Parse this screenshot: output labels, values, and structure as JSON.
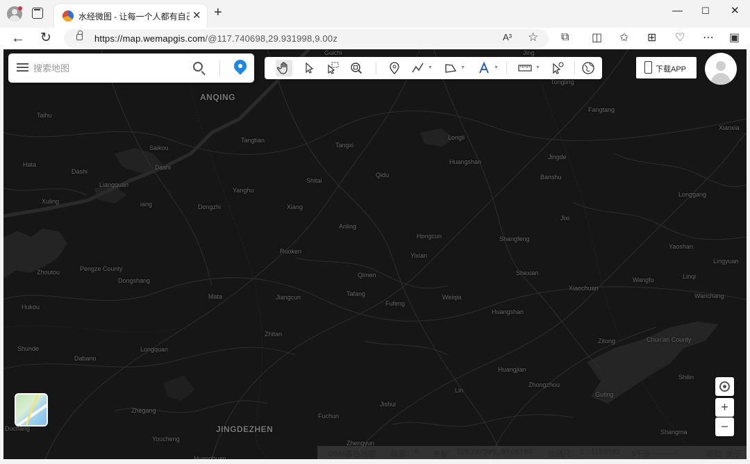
{
  "browser": {
    "tab_title": "水经微图 - 让每一个人都有自己的",
    "url_host": "https://map.wemapgis.com",
    "url_path": "/@117.740698,29.931998,9.00z",
    "read_aloud": "A³"
  },
  "search": {
    "placeholder": "搜索地图"
  },
  "download_app": {
    "label": "下载APP"
  },
  "map_controls": {
    "zoom_in": "+",
    "zoom_out": "−"
  },
  "places": [
    {
      "name": "Guichi"
    },
    {
      "name": "Jing"
    },
    {
      "name": "ANQING",
      "big": true
    },
    {
      "name": "Taihu"
    },
    {
      "name": "Tongling"
    },
    {
      "name": "Fangtang"
    },
    {
      "name": "Xianxia"
    },
    {
      "name": "Saikou"
    },
    {
      "name": "Tangtian"
    },
    {
      "name": "Tangxi"
    },
    {
      "name": "Longli"
    },
    {
      "name": "Jingde"
    },
    {
      "name": "Huangshan"
    },
    {
      "name": "Dashi"
    },
    {
      "name": "Hata"
    },
    {
      "name": "Dashi"
    },
    {
      "name": "Shitai"
    },
    {
      "name": "Qidu"
    },
    {
      "name": "Banshu"
    },
    {
      "name": "Liangquan"
    },
    {
      "name": "Yanghu"
    },
    {
      "name": "Longgang"
    },
    {
      "name": "Xuling"
    },
    {
      "name": "iang"
    },
    {
      "name": "Dongzhi"
    },
    {
      "name": "Xiang"
    },
    {
      "name": "Jixi"
    },
    {
      "name": "Anling"
    },
    {
      "name": "Hongcun"
    },
    {
      "name": "Shangfeng"
    },
    {
      "name": "Yaoshan"
    },
    {
      "name": "Ruoken"
    },
    {
      "name": "Yixian"
    },
    {
      "name": "Lingyuan"
    },
    {
      "name": "Zhoutou"
    },
    {
      "name": "Pengze County"
    },
    {
      "name": "Qimen"
    },
    {
      "name": "Shexian"
    },
    {
      "name": "Linqi"
    },
    {
      "name": "Dongshang"
    },
    {
      "name": "Wangfu"
    },
    {
      "name": "Xiaochuan"
    },
    {
      "name": "Mata"
    },
    {
      "name": "Jiangcun"
    },
    {
      "name": "Tafang"
    },
    {
      "name": "Weiqia"
    },
    {
      "name": "Wanchang"
    },
    {
      "name": "Hukou"
    },
    {
      "name": "Fufeng"
    },
    {
      "name": "Huangshan"
    },
    {
      "name": "Zhitan"
    },
    {
      "name": "Zitong"
    },
    {
      "name": "Chun'an County"
    },
    {
      "name": "Shunde"
    },
    {
      "name": "Longquan"
    },
    {
      "name": "Dabano"
    },
    {
      "name": "Huangjian"
    },
    {
      "name": "Shilin"
    },
    {
      "name": "Zhongzhou"
    },
    {
      "name": "Lin"
    },
    {
      "name": "Guting"
    },
    {
      "name": "Jishui"
    },
    {
      "name": "Zhegang"
    },
    {
      "name": "Fuchun"
    },
    {
      "name": "Duchang"
    },
    {
      "name": "JINGDEZHEN",
      "big": true
    },
    {
      "name": "Youcheng"
    },
    {
      "name": "Zhengyun"
    },
    {
      "name": "Shangma"
    },
    {
      "name": "Huanghuan"
    }
  ],
  "status_bar": {
    "source": "OSM黑色地图",
    "level_label": "级别：",
    "level_value": "9",
    "coord_label": "坐标：",
    "coord_value": "119.237585, 30.06184",
    "scale_label": "比例尺：",
    "scale_value": "1 : 1155581",
    "scale_distance": "5千米",
    "help": "帮助",
    "about": "关于"
  }
}
